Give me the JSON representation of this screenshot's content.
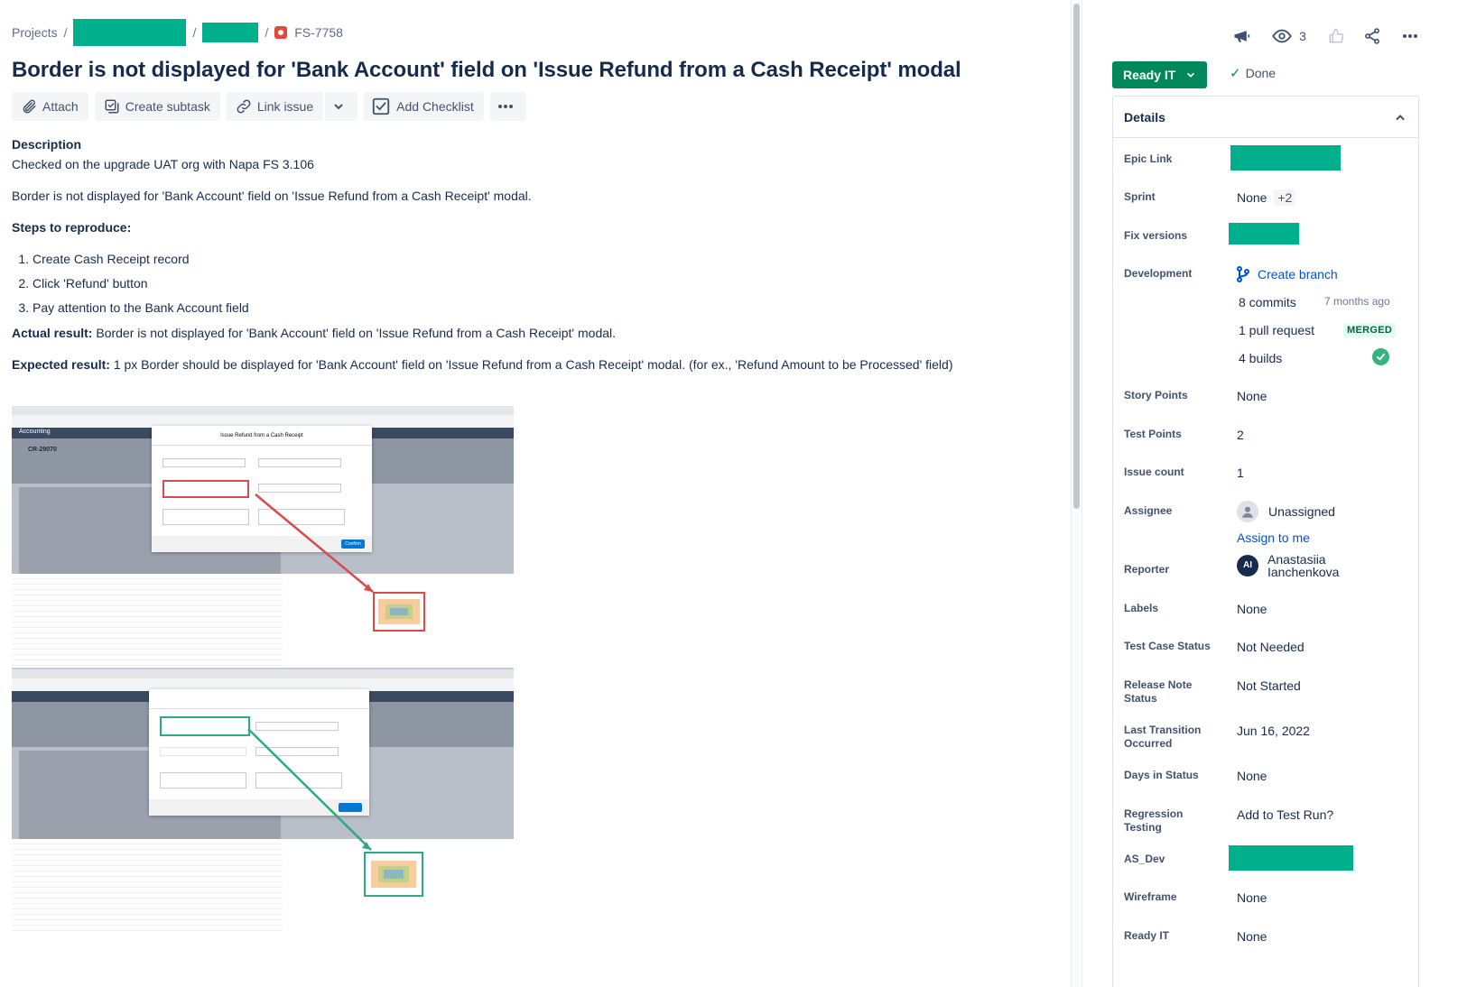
{
  "breadcrumb": {
    "projects": "Projects",
    "sep": "/",
    "issue_key": "FS-7758"
  },
  "title": "Border is not displayed for 'Bank Account' field on 'Issue Refund from a Cash Receipt' modal",
  "toolbar": {
    "attach": "Attach",
    "create_subtask": "Create subtask",
    "link_issue": "Link issue",
    "add_checklist": "Add Checklist"
  },
  "description": {
    "heading": "Description",
    "line1": "Checked on the upgrade UAT org with Napa FS 3.106",
    "line2": "Border is not displayed for 'Bank Account' field on 'Issue Refund from a Cash Receipt' modal.",
    "steps_heading": "Steps to reproduce:",
    "steps": [
      "Create Cash Receipt record",
      "Click 'Refund' button",
      "Pay attention to the Bank Account field"
    ],
    "actual_label": "Actual result:",
    "actual_text": " Border is not displayed for 'Bank Account' field on 'Issue Refund from a Cash Receipt' modal.",
    "expected_label": "Expected result:",
    "expected_text": " 1 px Border should be displayed for 'Bank Account' field on 'Issue Refund from a Cash Receipt' modal. (for ex., 'Refund Amount to be Processed' field)"
  },
  "attachment": {
    "modal_title": "Issue Refund from a Cash Receipt",
    "record_id": "CR-29070",
    "app_name": "Accounting",
    "confirm": "Confirm"
  },
  "sidebar": {
    "watchers_count": "3",
    "status": "Ready IT",
    "resolution": "Done",
    "details_heading": "Details",
    "fields": {
      "epic_link": "Epic Link",
      "sprint": "Sprint",
      "sprint_value": "None",
      "sprint_more": "+2",
      "fix_versions": "Fix versions",
      "development": "Development",
      "create_branch": "Create branch",
      "commits": "8 commits",
      "commits_time": "7 months ago",
      "pull_request": "1 pull request",
      "merged": "MERGED",
      "builds": "4 builds",
      "story_points": "Story Points",
      "story_points_value": "None",
      "test_points": "Test Points",
      "test_points_value": "2",
      "issue_count": "Issue count",
      "issue_count_value": "1",
      "assignee": "Assignee",
      "assignee_value": "Unassigned",
      "assign_to_me": "Assign to me",
      "reporter": "Reporter",
      "reporter_initials": "AI",
      "reporter_first": "Anastasiia",
      "reporter_last": "Ianchenkova",
      "labels": "Labels",
      "labels_value": "None",
      "test_case_status": "Test Case Status",
      "test_case_status_value": "Not Needed",
      "release_note_status_1": "Release Note",
      "release_note_status_2": "Status",
      "release_note_status_value": "Not Started",
      "last_transition_1": "Last Transition",
      "last_transition_2": "Occurred",
      "last_transition_value": "Jun 16, 2022",
      "days_in_status": "Days in Status",
      "days_in_status_value": "None",
      "regression_1": "Regression",
      "regression_2": "Testing",
      "regression_value": "Add to Test Run?",
      "as_dev": "AS_Dev",
      "wireframe": "Wireframe",
      "wireframe_value": "None",
      "ready_it": "Ready IT",
      "ready_it_value": "None"
    }
  },
  "colors": {
    "redaction": "#00b08c",
    "status_green": "#00875a",
    "link_blue": "#0052cc"
  }
}
